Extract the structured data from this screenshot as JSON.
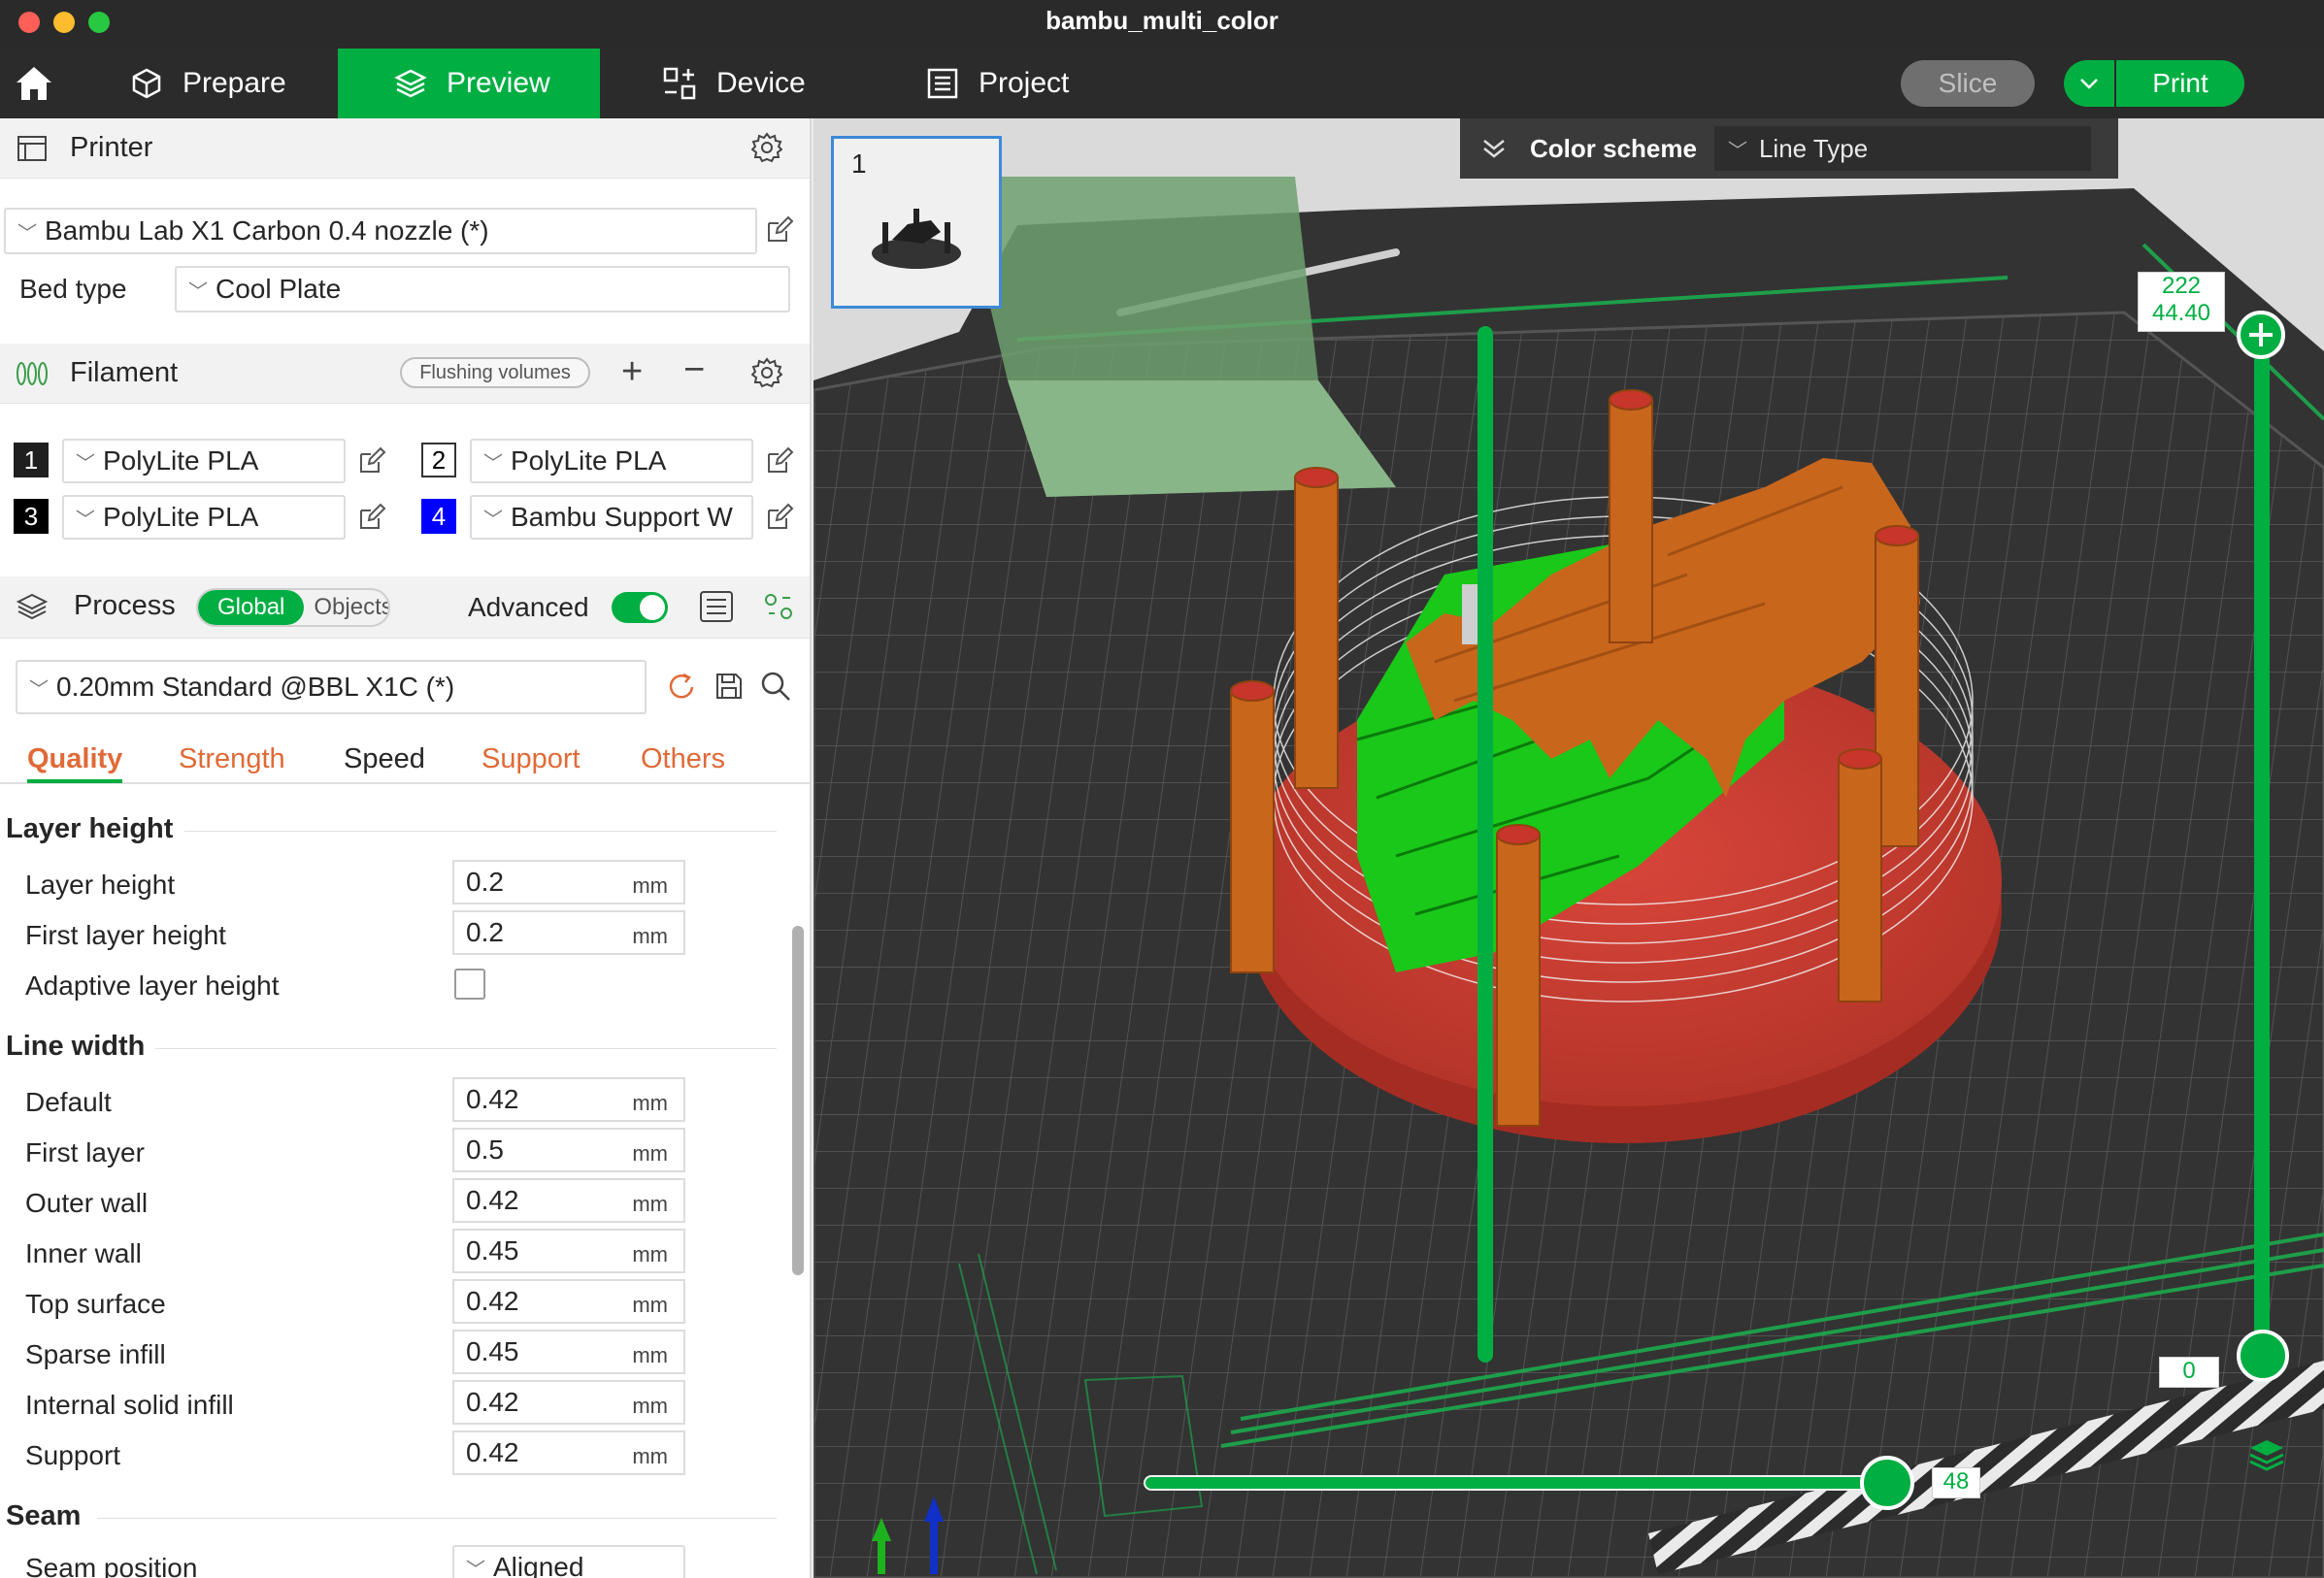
{
  "window": {
    "title": "bambu_multi_color"
  },
  "nav": {
    "tabs": [
      {
        "label": "Prepare"
      },
      {
        "label": "Preview"
      },
      {
        "label": "Device"
      },
      {
        "label": "Project"
      }
    ],
    "slice_label": "Slice",
    "print_label": "Print"
  },
  "printer": {
    "section_title": "Printer",
    "preset": "Bambu Lab X1 Carbon 0.4 nozzle (*)",
    "bed_type_label": "Bed type",
    "bed_type": "Cool Plate"
  },
  "filament": {
    "section_title": "Filament",
    "flushing_label": "Flushing volumes",
    "slots": [
      {
        "num": "1",
        "name": "PolyLite PLA",
        "color": "#1f1f1f",
        "text_color": "#ffffff"
      },
      {
        "num": "2",
        "name": "PolyLite PLA",
        "color": "#ffffff",
        "text_color": "#000000"
      },
      {
        "num": "3",
        "name": "PolyLite PLA",
        "color": "#000000",
        "text_color": "#ffffff"
      },
      {
        "num": "4",
        "name": "Bambu Support W",
        "color": "#0000ff",
        "text_color": "#ffffff"
      }
    ]
  },
  "process": {
    "section_title": "Process",
    "seg_global": "Global",
    "seg_objects": "Objects",
    "advanced_label": "Advanced",
    "advanced_on": true,
    "preset": "0.20mm Standard @BBL X1C (*)",
    "tabs": [
      "Quality",
      "Strength",
      "Speed",
      "Support",
      "Others"
    ],
    "groups": {
      "layer_height": {
        "title": "Layer height",
        "layer_height_label": "Layer height",
        "layer_height": "0.2",
        "first_layer_label": "First layer height",
        "first_layer": "0.2",
        "adaptive_label": "Adaptive layer height"
      },
      "line_width": {
        "title": "Line width",
        "rows": [
          {
            "label": "Default",
            "value": "0.42"
          },
          {
            "label": "First layer",
            "value": "0.5"
          },
          {
            "label": "Outer wall",
            "value": "0.42"
          },
          {
            "label": "Inner wall",
            "value": "0.45"
          },
          {
            "label": "Top surface",
            "value": "0.42"
          },
          {
            "label": "Sparse infill",
            "value": "0.45"
          },
          {
            "label": "Internal solid infill",
            "value": "0.42"
          },
          {
            "label": "Support",
            "value": "0.42"
          }
        ]
      },
      "seam": {
        "title": "Seam",
        "position_label": "Seam position",
        "position_value": "Aligned"
      }
    },
    "unit": "mm"
  },
  "viewport": {
    "plate_number": "1",
    "color_scheme_label": "Color scheme",
    "color_scheme_value": "Line Type",
    "vslider_top": "222",
    "vslider_top_height": "44.40",
    "vslider_bottom": "0",
    "hslider_value": "48",
    "colors": {
      "accent": "#00ae42",
      "model": "#c8661c",
      "support": "#19c819",
      "raft": "#c43d32"
    }
  }
}
